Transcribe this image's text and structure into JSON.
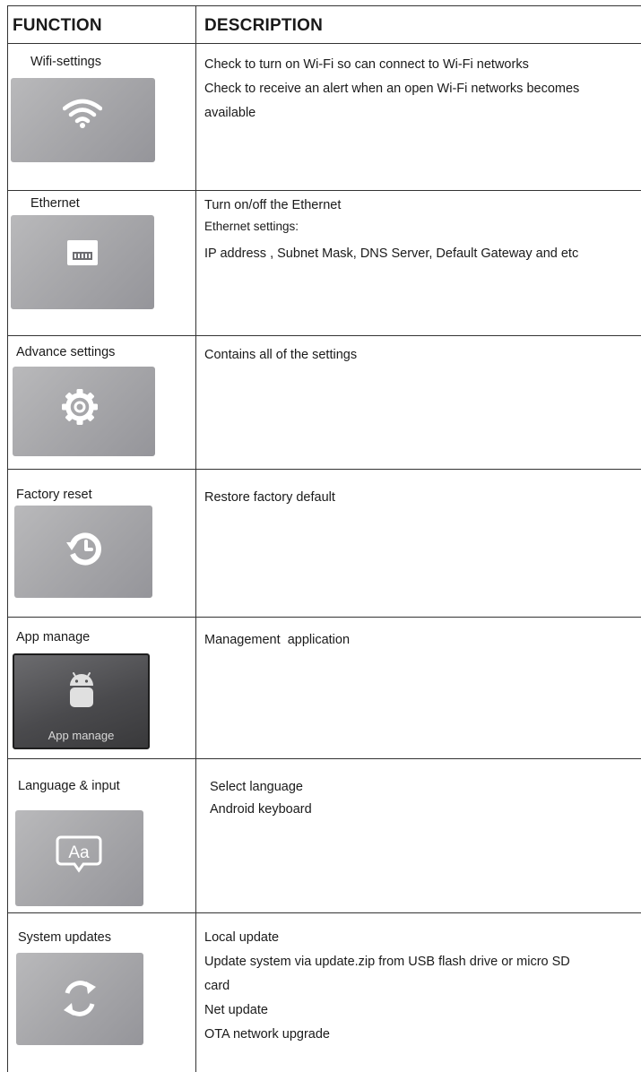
{
  "header": {
    "function": "FUNCTION",
    "description": "DESCRIPTION"
  },
  "rows": [
    {
      "function": "Wifi-settings",
      "icon": "wifi-icon",
      "description": [
        "Check to turn on Wi-Fi so can connect to Wi-Fi networks",
        "Check to receive an alert when an open Wi-Fi networks becomes",
        "available"
      ]
    },
    {
      "function": "Ethernet",
      "icon": "ethernet-port-icon",
      "description": [
        "Turn on/off the Ethernet",
        "Ethernet settings:",
        "IP address , Subnet Mask, DNS Server, Default Gateway and etc"
      ]
    },
    {
      "function": "Advance settings",
      "icon": "gear-icon",
      "description": [
        "Contains all of the settings"
      ]
    },
    {
      "function": "Factory reset",
      "icon": "restore-clock-icon",
      "description": [
        "Restore factory default"
      ]
    },
    {
      "function": "App manage",
      "icon": "android-icon",
      "tile_caption": "App manage",
      "description": [
        "Management  application"
      ]
    },
    {
      "function": "Language & input",
      "icon": "language-aa-icon",
      "description": [
        "Select language",
        "Android keyboard"
      ]
    },
    {
      "function": "System updates",
      "icon": "refresh-icon",
      "description": [
        "Local update",
        "Update system via update.zip from USB flash drive or micro SD",
        "card",
        "Net update",
        "OTA network upgrade"
      ]
    }
  ]
}
